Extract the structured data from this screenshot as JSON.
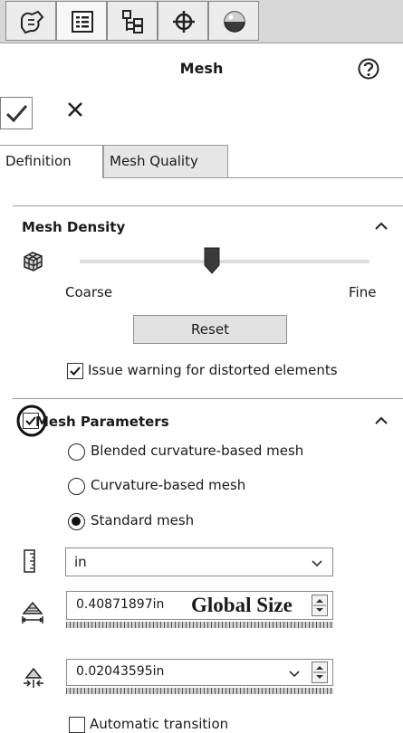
{
  "toolbar": {
    "icons": [
      "property-manager-icon",
      "feature-tree-icon",
      "configuration-manager-icon",
      "dimxpert-icon",
      "display-manager-icon"
    ],
    "active_index": 1
  },
  "panel": {
    "title": "Mesh"
  },
  "tabs": [
    {
      "label": "Definition",
      "active": true
    },
    {
      "label": "Mesh Quality",
      "active": false
    }
  ],
  "mesh_density": {
    "heading": "Mesh Density",
    "slider_level": 0.5,
    "coarse_label": "Coarse",
    "fine_label": "Fine",
    "reset_label": "Reset",
    "warning_checkbox": {
      "label": "Issue warning for distorted elements",
      "checked": true
    }
  },
  "mesh_parameters": {
    "heading": "Mesh Parameters",
    "enabled": true,
    "options": [
      {
        "label": "Blended curvature-based mesh",
        "selected": false
      },
      {
        "label": "Curvature-based mesh",
        "selected": false
      },
      {
        "label": "Standard mesh",
        "selected": true
      }
    ],
    "unit": "in",
    "global_size": "0.40871897in",
    "global_size_annotation": "Global Size",
    "tolerance": "0.02043595in",
    "automatic_transition": {
      "label": "Automatic transition",
      "checked": false
    }
  },
  "colors": {
    "toolbar_bg": "#d7d7d7",
    "button_face": "#e1e1e1",
    "border": "#8a8a8a"
  }
}
